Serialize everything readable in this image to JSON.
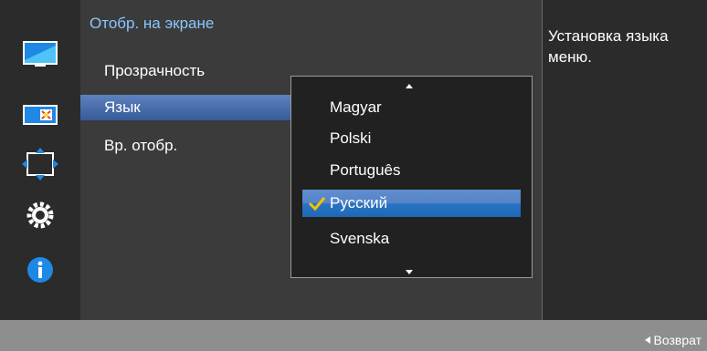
{
  "menu": {
    "title": "Отобр. на экране",
    "items": [
      {
        "label": "Прозрачность"
      },
      {
        "label": "Язык"
      },
      {
        "label": "Вр. отобр."
      }
    ]
  },
  "dropdown": {
    "options": [
      "Magyar",
      "Polski",
      "Português",
      "Русский",
      "Svenska"
    ],
    "selected": "Русский"
  },
  "help": {
    "text": "Установка языка меню."
  },
  "footer": {
    "return_label": "Возврат"
  },
  "sidebar": {
    "icons": [
      "picture-icon",
      "color-icon",
      "position-icon",
      "settings-icon",
      "info-icon"
    ]
  },
  "colors": {
    "title": "#8bc6ff",
    "highlight": "#5d82bf",
    "dropdown_selected": "#2a74c5",
    "check": "#f5c200",
    "accent_blue": "#1e88e5"
  }
}
